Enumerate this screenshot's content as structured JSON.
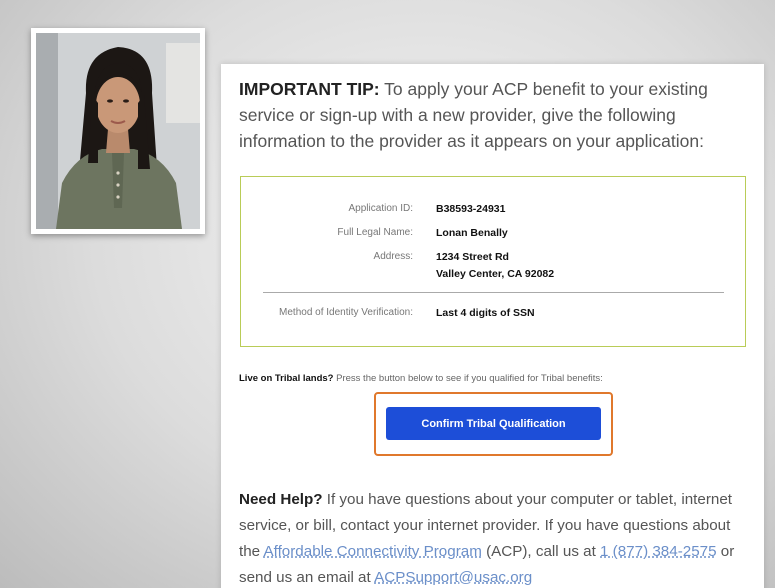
{
  "tip": {
    "heading": "IMPORTANT TIP:",
    "body": " To apply your ACP benefit to your existing service or sign-up with a new provider, give the following information to the provider as it appears on your application:"
  },
  "application": {
    "id_label": "Application ID:",
    "id_value": "B38593-24931",
    "name_label": "Full Legal Name:",
    "name_value": "Lonan Benally",
    "address_label": "Address:",
    "address_line1": "1234 Street Rd",
    "address_line2": "Valley Center, CA 92082",
    "method_label": "Method of Identity Verification:",
    "method_value": "Last 4 digits of SSN"
  },
  "tribal": {
    "question": "Live on Tribal lands?",
    "instruction": " Press the button below to see if you qualified for Tribal benefits:",
    "button_label": "Confirm Tribal Qualification"
  },
  "help": {
    "heading": "Need Help?",
    "text1": " If you have questions about your computer or tablet, internet service, or bill, contact your internet provider. If you have questions about the ",
    "program_link": "Affordable Connectivity Program",
    "text2": " (ACP), call us at ",
    "phone_link": "1 (877) 384-2575",
    "text3": " or send us an email at ",
    "email_link": "ACPSupport@usac.org"
  },
  "colors": {
    "button": "#1d4ed8",
    "highlight": "#e0782c",
    "box_border": "#b9cc57",
    "link": "#6b8fc9"
  }
}
